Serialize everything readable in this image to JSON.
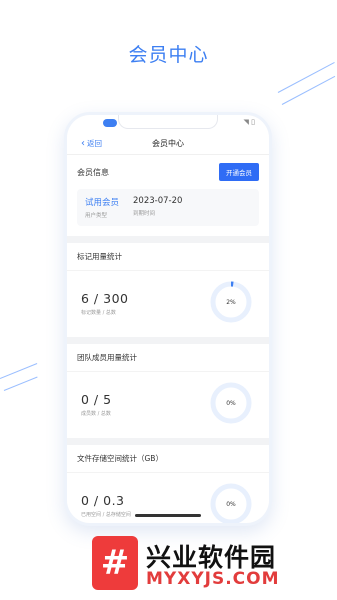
{
  "hero": {
    "title": "会员中心"
  },
  "status": {
    "right": "◥ ▯"
  },
  "nav": {
    "back_label": "返回",
    "title": "会员中心"
  },
  "member": {
    "section_title": "会员信息",
    "open_button": "开通会员",
    "type_value": "试用会员",
    "type_label": "用户类型",
    "expiry_value": "2023-07-20",
    "expiry_label": "到期时间"
  },
  "cards": [
    {
      "title": "标记用量统计",
      "value": "6 / 300",
      "label": "标记数量 / 总数",
      "percent_text": "2%",
      "percent": 2
    },
    {
      "title": "团队成员用量统计",
      "value": "0 / 5",
      "label": "成员数 / 总数",
      "percent_text": "0%",
      "percent": 0
    },
    {
      "title": "文件存储空间统计（GB）",
      "value": "0 / 0.3",
      "label": "已用空间 / 总存储空间",
      "percent_text": "0%",
      "percent": 0
    }
  ],
  "banner": {
    "logo_char": "#",
    "name_cn": "兴业软件园",
    "name_en": "MYXYJS.COM"
  },
  "colors": {
    "accent": "#3d7ff2",
    "button": "#2f6cf5",
    "ring_track": "#e8f0fd",
    "brand_red": "#e23c3c"
  }
}
